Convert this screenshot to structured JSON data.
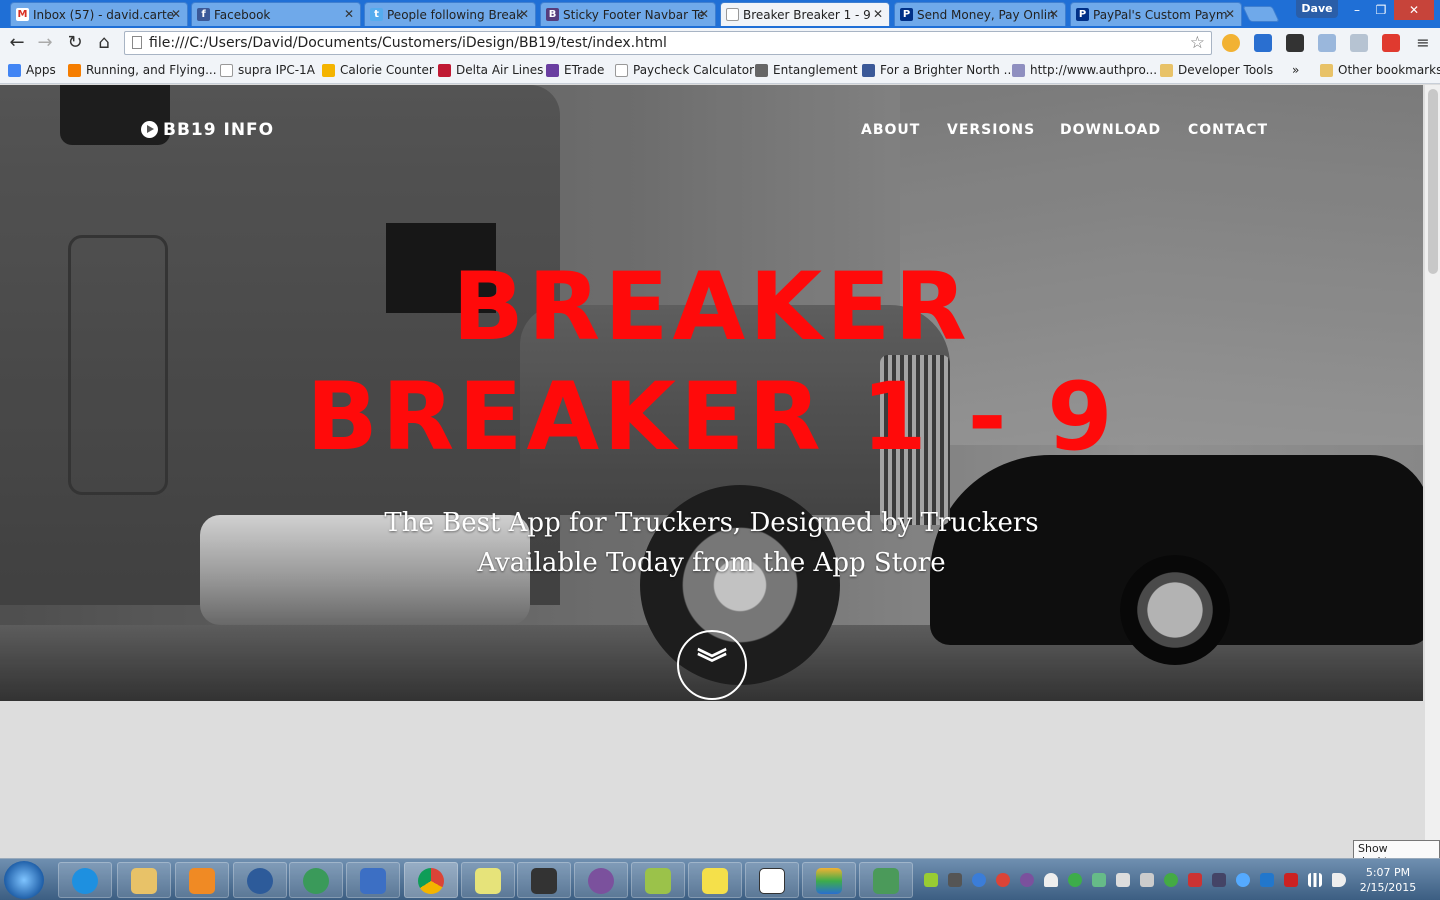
{
  "browser": {
    "tabs": [
      {
        "title": "Inbox (57) - david.carte",
        "color": "#d93025"
      },
      {
        "title": "Facebook",
        "color": "#3b5998"
      },
      {
        "title": "People following Break",
        "color": "#55acee"
      },
      {
        "title": "Sticky Footer Navbar Te",
        "color": "#563d7c"
      },
      {
        "title": "Breaker Breaker 1 - 9",
        "color": "#ffffff"
      },
      {
        "title": "Send Money, Pay Onlin",
        "color": "#003087"
      },
      {
        "title": "PayPal's Custom Paym",
        "color": "#003087"
      }
    ],
    "profile_name": "Dave",
    "window_controls": [
      "–",
      "❐",
      "✕"
    ],
    "address": "file:///C:/Users/David/Documents/Customers/iDesign/BB19/test/index.html",
    "bookmarks": [
      {
        "label": "Apps",
        "color": "#4285f4"
      },
      {
        "label": "Running, and Flying...",
        "color": "#f57d00"
      },
      {
        "label": "supra IPC-1A",
        "color": "#ffffff"
      },
      {
        "label": "Calorie Counter",
        "color": "#f4b400"
      },
      {
        "label": "Delta Air Lines",
        "color": "#c01933"
      },
      {
        "label": "ETrade",
        "color": "#6a3ea1"
      },
      {
        "label": "Paycheck Calculator",
        "color": "#ffffff"
      },
      {
        "label": "Entanglement",
        "color": "#666666"
      },
      {
        "label": "For a Brighter North ...",
        "color": "#3b5998"
      },
      {
        "label": "http://www.authpro...",
        "color": "#8f8fc0"
      },
      {
        "label": "Developer Tools",
        "color": "#e8c268"
      }
    ],
    "more_bookmarks": "»",
    "other_bookmarks": "Other bookmarks"
  },
  "site": {
    "brand": "BB19 INFO",
    "nav": [
      "ABOUT",
      "VERSIONS",
      "DOWNLOAD",
      "CONTACT"
    ],
    "headline_line1": "BREAKER",
    "headline_line2": "BREAKER 1 - 9",
    "tagline_line1": "The Best App for Truckers, Designed by Truckers",
    "tagline_line2": "Available Today from the App Store",
    "scroll_glyph": "︾",
    "headline_color": "#ff0a0a"
  },
  "taskbar": {
    "time": "5:07 PM",
    "date": "2/15/2015",
    "show_desktop_tooltip": "Show desktop"
  }
}
